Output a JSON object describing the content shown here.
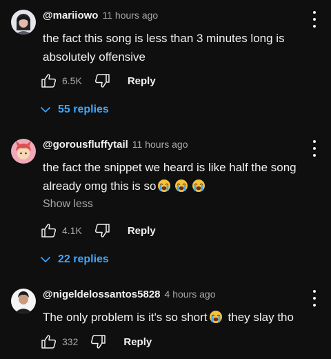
{
  "comments": [
    {
      "username": "@mariiowo",
      "timestamp": "11 hours ago",
      "text_lines": [
        "the fact this song is less than 3 minutes long is",
        "absolutely offensive"
      ],
      "likes": "6.5K",
      "reply_label": "Reply",
      "replies_label": "55 replies"
    },
    {
      "username": "@gorousfluffytail",
      "timestamp": "11 hours ago",
      "text_lines": [
        "the fact the snippet we heard is like half the song",
        "already omg this is so"
      ],
      "show_less_label": "Show less",
      "likes": "4.1K",
      "reply_label": "Reply",
      "replies_label": "22 replies"
    },
    {
      "username": "@nigeldelossantos5828",
      "timestamp": "4 hours ago",
      "text_before_emoji": "The only problem is it's so short",
      "text_after_emoji": "they slay tho",
      "likes": "332",
      "reply_label": "Reply"
    }
  ],
  "icons": {
    "like": "thumbs-up-icon",
    "dislike": "thumbs-down-icon",
    "more": "more-vert-icon",
    "expand": "chevron-down-icon",
    "emoji": "loudly-crying-face-emoji"
  },
  "colors": {
    "background": "#0f0f0f",
    "text": "#f1f1f1",
    "secondary": "#aaaaaa",
    "link": "#3ea6ff"
  }
}
